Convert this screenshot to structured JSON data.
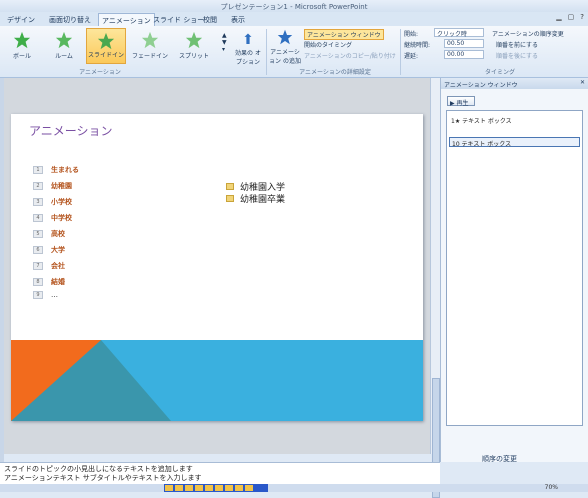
{
  "app": {
    "title": "プレゼンテーション1 - Microsoft PowerPoint"
  },
  "tabs": [
    "デザイン",
    "画面切り替え",
    "アニメーション",
    "スライド ショー",
    "校閲",
    "表示"
  ],
  "active_tab": 2,
  "ribbon": {
    "animations": [
      "ボール",
      "ルーム",
      "スライドイン",
      "フェードイン",
      "スプリット"
    ],
    "selected_animation": 2,
    "effect_options": "効果の オプション",
    "group_animation": "アニメーション",
    "add_animation": "アニメーション の追加",
    "animation_pane_btn": "アニメーション ウィンドウ",
    "trigger_btn": "開始のタイミング",
    "painter_btn": "アニメーションのコピー/貼り付け",
    "group_advanced": "アニメーションの詳細設定",
    "start_label": "開始:",
    "start_value": "クリック時",
    "duration_label": "継続時間:",
    "duration_value": "00.50",
    "delay_label": "遅延:",
    "delay_value": "00.00",
    "reorder_label": "アニメーションの順序変更",
    "move_earlier": "順番を前にする",
    "move_later": "順番を後にする",
    "group_timing": "タイミング"
  },
  "slide": {
    "title": "アニメーション",
    "items": [
      "生まれる",
      "幼稚園",
      "小学校",
      "中学校",
      "高校",
      "大学",
      "会社",
      "結婚",
      "…"
    ],
    "right_items": [
      "幼稚園入学",
      "幼稚園卒業"
    ]
  },
  "pane": {
    "title": "アニメーション ウィンドウ",
    "play": "再生",
    "entries": [
      "1★ テキスト ボックス",
      "10 テキスト ボックス"
    ],
    "reorder": "順序の変更"
  },
  "notes": {
    "line1": "スライドのトピックの小見出しになるテキストを追加します",
    "line2": "アニメーションテキスト サブタイトルやテキストを入力します"
  },
  "status": {
    "zoom": "70%"
  },
  "colors": {
    "orange": "#f26b1d",
    "blue": "#3ab0df",
    "teal": "#3a96ac",
    "accent": "#7a4fa3"
  }
}
